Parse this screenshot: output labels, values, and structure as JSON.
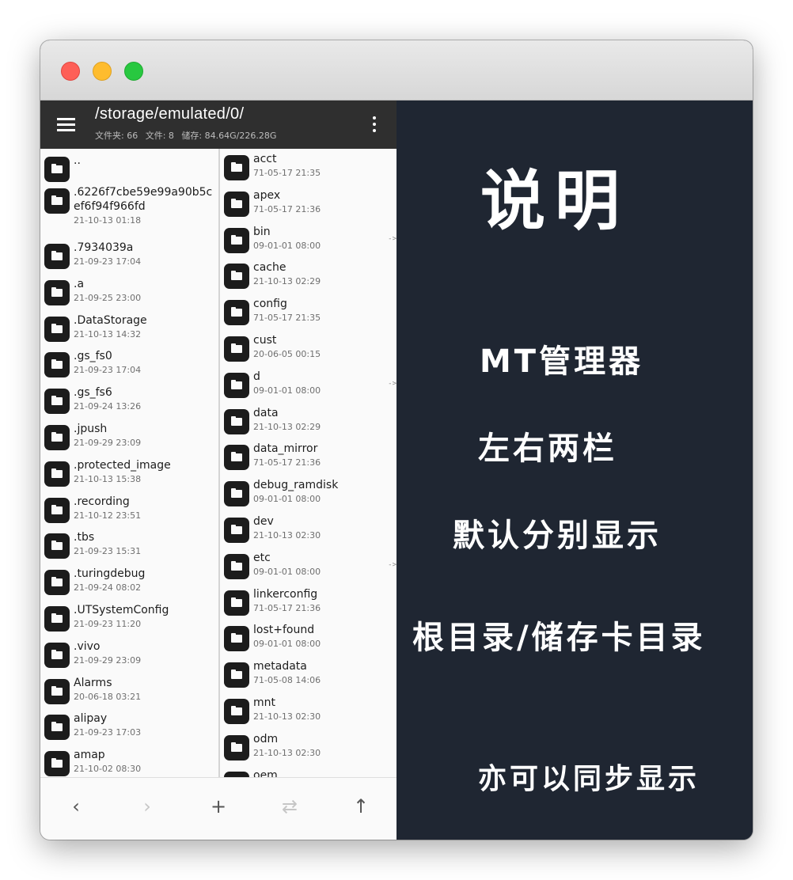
{
  "header": {
    "path": "/storage/emulated/0/",
    "folders_label": "文件夹: 66",
    "files_label": "文件: 8",
    "storage_label": "储存: 84.64G/226.28G"
  },
  "left_pane": [
    {
      "name": "..",
      "date": ""
    },
    {
      "name": ".6226f7cbe59e99a90b5cef6f94f966fd",
      "date": "21-10-13 01:18"
    },
    {
      "name": ".7934039a",
      "date": "21-09-23 17:04"
    },
    {
      "name": ".a",
      "date": "21-09-25 23:00"
    },
    {
      "name": ".DataStorage",
      "date": "21-10-13 14:32"
    },
    {
      "name": ".gs_fs0",
      "date": "21-09-23 17:04"
    },
    {
      "name": ".gs_fs6",
      "date": "21-09-24 13:26"
    },
    {
      "name": ".jpush",
      "date": "21-09-29 23:09"
    },
    {
      "name": ".protected_image",
      "date": "21-10-13 15:38"
    },
    {
      "name": ".recording",
      "date": "21-10-12 23:51"
    },
    {
      "name": ".tbs",
      "date": "21-09-23 15:31"
    },
    {
      "name": ".turingdebug",
      "date": "21-09-24 08:02"
    },
    {
      "name": ".UTSystemConfig",
      "date": "21-09-23 11:20"
    },
    {
      "name": ".vivo",
      "date": "21-09-29 23:09"
    },
    {
      "name": "Alarms",
      "date": "20-06-18 03:21"
    },
    {
      "name": "alipay",
      "date": "21-09-23 17:03"
    },
    {
      "name": "amap",
      "date": "21-10-02 08:30"
    }
  ],
  "right_pane": [
    {
      "name": "acct",
      "date": "71-05-17 21:35",
      "link": false
    },
    {
      "name": "apex",
      "date": "71-05-17 21:36",
      "link": false
    },
    {
      "name": "bin",
      "date": "09-01-01 08:00",
      "link": true
    },
    {
      "name": "cache",
      "date": "21-10-13 02:29",
      "link": false
    },
    {
      "name": "config",
      "date": "71-05-17 21:35",
      "link": false
    },
    {
      "name": "cust",
      "date": "20-06-05 00:15",
      "link": false
    },
    {
      "name": "d",
      "date": "09-01-01 08:00",
      "link": true
    },
    {
      "name": "data",
      "date": "21-10-13 02:29",
      "link": false
    },
    {
      "name": "data_mirror",
      "date": "71-05-17 21:36",
      "link": false
    },
    {
      "name": "debug_ramdisk",
      "date": "09-01-01 08:00",
      "link": false
    },
    {
      "name": "dev",
      "date": "21-10-13 02:30",
      "link": false
    },
    {
      "name": "etc",
      "date": "09-01-01 08:00",
      "link": true
    },
    {
      "name": "linkerconfig",
      "date": "71-05-17 21:36",
      "link": false
    },
    {
      "name": "lost+found",
      "date": "09-01-01 08:00",
      "link": false
    },
    {
      "name": "metadata",
      "date": "71-05-08 14:06",
      "link": false
    },
    {
      "name": "mnt",
      "date": "21-10-13 02:30",
      "link": false
    },
    {
      "name": "odm",
      "date": "21-10-13 02:30",
      "link": false
    },
    {
      "name": "oem",
      "date": "",
      "link": false
    }
  ],
  "link_arrow": "->",
  "bottom_bar": {
    "back": "‹",
    "forward": "›",
    "add": "+",
    "swap": "⇄",
    "up": "↑"
  },
  "notes": {
    "title": "说明",
    "line1": "MT管理器",
    "line2": "左右两栏",
    "line3": "默认分别显示",
    "line4": "根目录/储存卡目录",
    "line5": "亦可以同步显示"
  },
  "colors": {
    "app_bar": "#2f2f2f",
    "notes_bg": "#1f2632",
    "folder_icon": "#1c1c1c"
  }
}
